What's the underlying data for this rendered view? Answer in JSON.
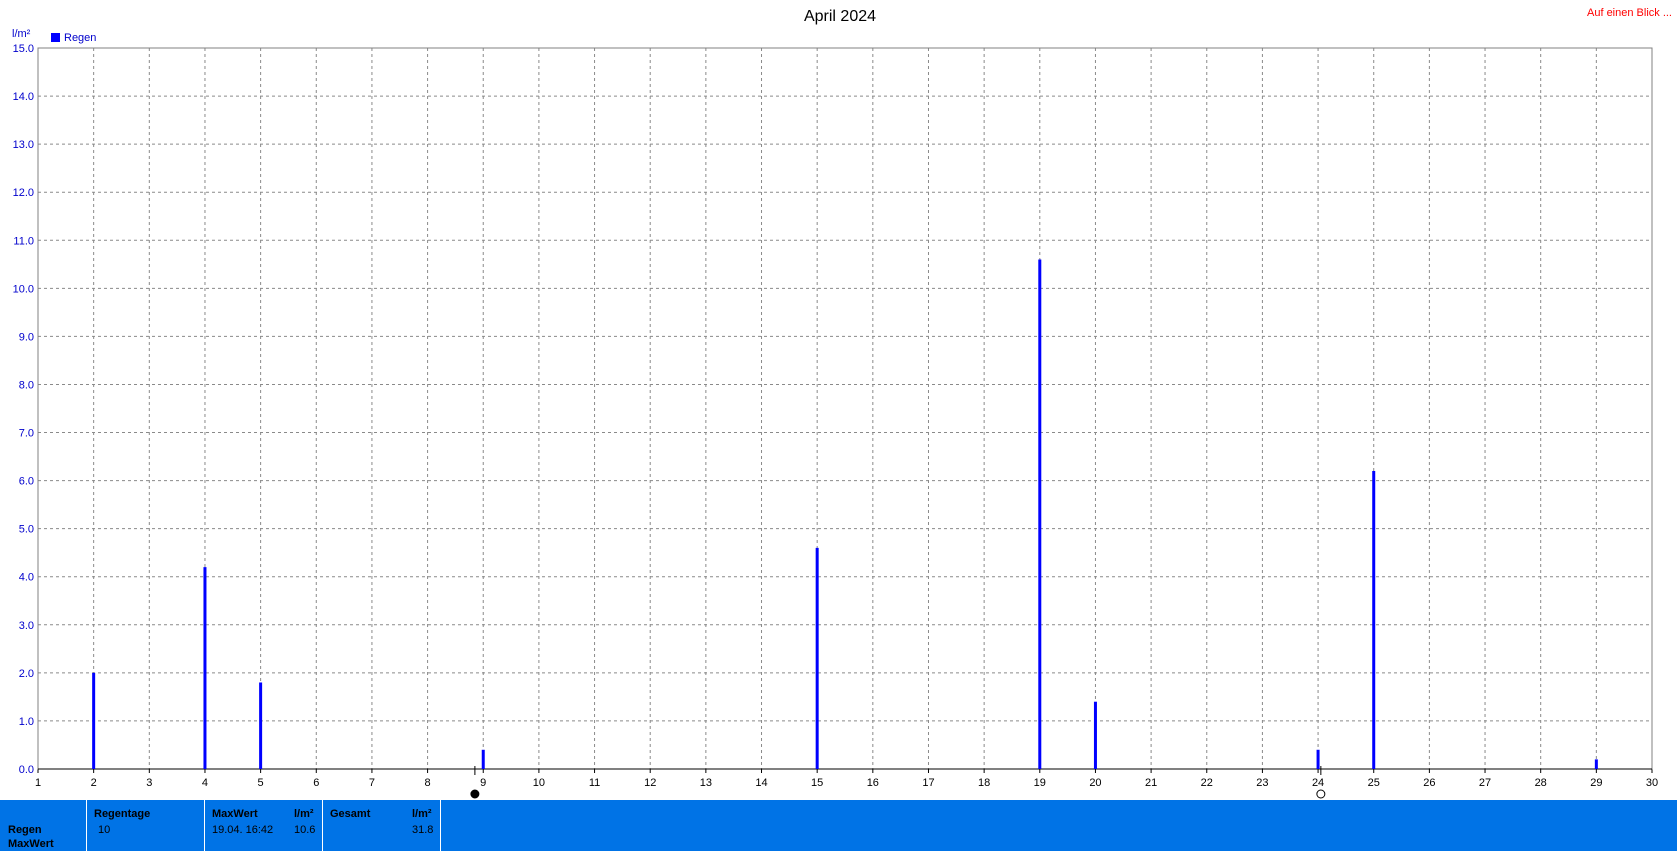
{
  "header": {
    "link_text": "Auf einen Blick ...",
    "unit": "l/m²"
  },
  "chart_data": {
    "type": "bar",
    "title": "April 2024",
    "ylabel": "l/m²",
    "xlabel": "",
    "ylim": [
      0,
      15
    ],
    "yticks": [
      "0.0",
      "1.0",
      "2.0",
      "3.0",
      "4.0",
      "5.0",
      "6.0",
      "7.0",
      "8.0",
      "9.0",
      "10.0",
      "11.0",
      "12.0",
      "13.0",
      "14.0",
      "15.0"
    ],
    "xlim": [
      1,
      30
    ],
    "xticks": [
      "1",
      "2",
      "3",
      "4",
      "5",
      "6",
      "7",
      "8",
      "9",
      "10",
      "11",
      "12",
      "13",
      "14",
      "15",
      "16",
      "17",
      "18",
      "19",
      "20",
      "21",
      "22",
      "23",
      "24",
      "25",
      "26",
      "27",
      "28",
      "29",
      "30"
    ],
    "grid": true,
    "legend_position": "top-left",
    "series": [
      {
        "name": "Regen",
        "color": "#0000ff",
        "points": [
          {
            "x": 2,
            "y": 2.0
          },
          {
            "x": 4,
            "y": 4.2
          },
          {
            "x": 5,
            "y": 1.8
          },
          {
            "x": 9,
            "y": 0.4
          },
          {
            "x": 15,
            "y": 4.6
          },
          {
            "x": 19,
            "y": 10.6
          },
          {
            "x": 20,
            "y": 1.4
          },
          {
            "x": 24,
            "y": 0.4
          },
          {
            "x": 25,
            "y": 6.2
          },
          {
            "x": 29,
            "y": 0.2
          }
        ]
      }
    ],
    "moon_phases": [
      {
        "x": 8.85,
        "phase": "new-moon-icon"
      },
      {
        "x": 24.05,
        "phase": "full-moon-icon"
      }
    ]
  },
  "footer": {
    "row_label_1": "Regen",
    "row_label_2": "MaxWert",
    "regentage_header": "Regentage",
    "regentage_value": "10",
    "maxwert_header": "MaxWert",
    "maxwert_unit": "l/m²",
    "maxwert_date": "19.04.  16:42",
    "maxwert_value": "10.6",
    "gesamt_header": "Gesamt",
    "gesamt_unit": "l/m²",
    "gesamt_value": "31.8",
    "background_color": "#0073e6"
  }
}
